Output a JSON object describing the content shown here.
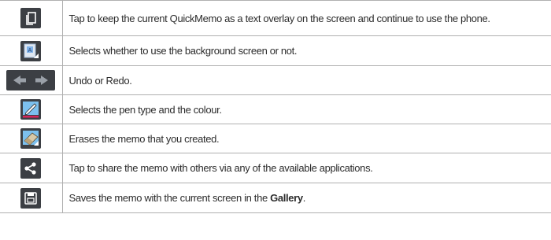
{
  "rows": [
    {
      "icon": "overlay-icon",
      "text": "Tap to keep the current QuickMemo as a text overlay on the screen and continue to use the phone."
    },
    {
      "icon": "background-toggle-icon",
      "text": "Selects whether to use the background screen or not."
    },
    {
      "icon": "undo-redo-icon",
      "text": "Undo or Redo."
    },
    {
      "icon": "pen-icon",
      "text": "Selects the pen type and the colour."
    },
    {
      "icon": "eraser-icon",
      "text": "Erases the memo that you created."
    },
    {
      "icon": "share-icon",
      "text": "Tap to share the memo with others via any of the available applications."
    },
    {
      "icon": "save-icon",
      "text_before": "Saves the memo with the current screen in the ",
      "text_bold": "Gallery",
      "text_after": "."
    }
  ],
  "colors": {
    "icon_background": "#3c3f44",
    "pen_line": "#d6265a",
    "icon_blue": "#2c7fd1",
    "border": "#b0b0b0"
  }
}
